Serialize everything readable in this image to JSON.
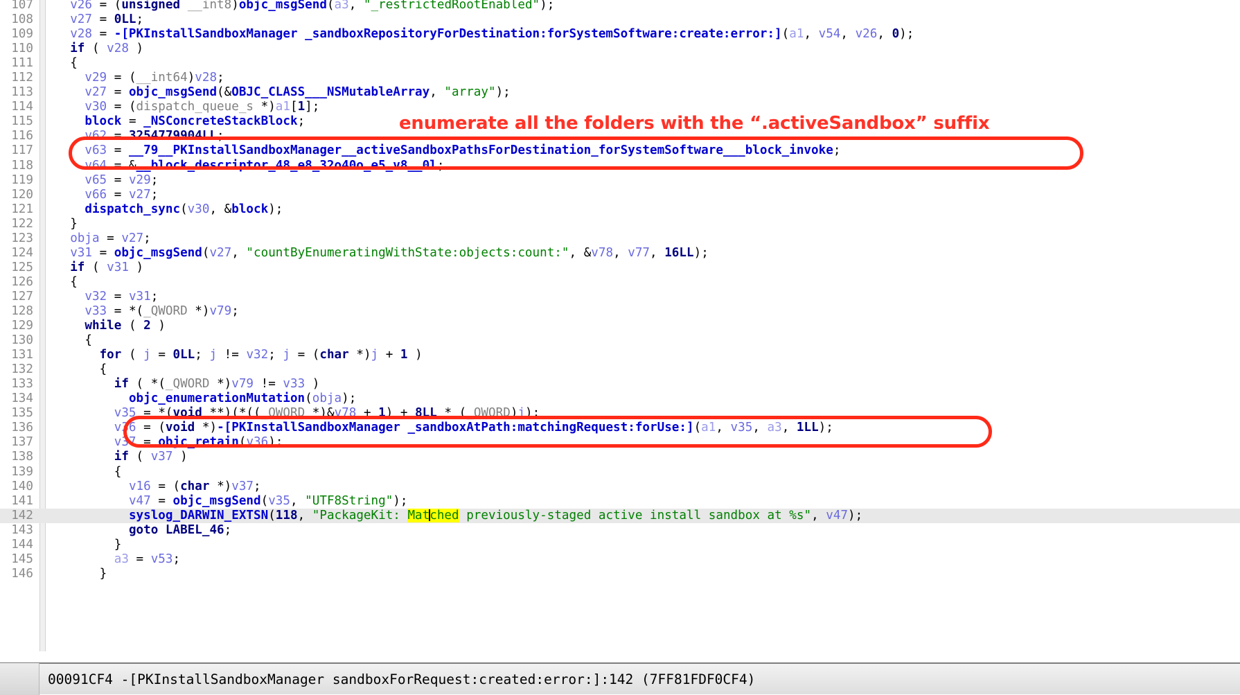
{
  "window": {
    "kind": "hex-rays-pseudocode-view"
  },
  "editor": {
    "first_line_number": 107,
    "highlighted_line_number": 142,
    "selected_word": "Matched",
    "selection_color": "#ffff00",
    "highlight_row_color": "#e8e8e8",
    "gutter_color": "#f0f0f0",
    "line_number_color": "#8b8b8b",
    "background": "#ffffff"
  },
  "syntax_colors": {
    "keyword": "#000080",
    "function": "#0000cf",
    "variable": "#6a6ade",
    "argument": "#9a9ae8",
    "string": "#008000",
    "type": "#808080",
    "plain": "#000000"
  },
  "code_lines": [
    {
      "n": 107,
      "text": "  v26 = (unsigned __int8)objc_msgSend(a3, \"_restrictedRootEnabled\");"
    },
    {
      "n": 108,
      "text": "  v27 = 0LL;"
    },
    {
      "n": 109,
      "text": "  v28 = -[PKInstallSandboxManager _sandboxRepositoryForDestination:forSystemSoftware:create:error:](a1, v54, v26, 0);"
    },
    {
      "n": 110,
      "text": "  if ( v28 )"
    },
    {
      "n": 111,
      "text": "  {"
    },
    {
      "n": 112,
      "text": "    v29 = (__int64)v28;"
    },
    {
      "n": 113,
      "text": "    v27 = objc_msgSend(&OBJC_CLASS___NSMutableArray, \"array\");"
    },
    {
      "n": 114,
      "text": "    v30 = (dispatch_queue_s *)a1[1];"
    },
    {
      "n": 115,
      "text": "    block = _NSConcreteStackBlock;"
    },
    {
      "n": 116,
      "text": "    v62 = 3254779904LL;"
    },
    {
      "n": 117,
      "text": "    v63 = __79__PKInstallSandboxManager__activeSandboxPathsForDestination_forSystemSoftware___block_invoke;"
    },
    {
      "n": 118,
      "text": "    v64 = &__block_descriptor_48_e8_32o40o_e5_v8__0l;"
    },
    {
      "n": 119,
      "text": "    v65 = v29;"
    },
    {
      "n": 120,
      "text": "    v66 = v27;"
    },
    {
      "n": 121,
      "text": "    dispatch_sync(v30, &block);"
    },
    {
      "n": 122,
      "text": "  }"
    },
    {
      "n": 123,
      "text": "  obja = v27;"
    },
    {
      "n": 124,
      "text": "  v31 = objc_msgSend(v27, \"countByEnumeratingWithState:objects:count:\", &v78, v77, 16LL);"
    },
    {
      "n": 125,
      "text": "  if ( v31 )"
    },
    {
      "n": 126,
      "text": "  {"
    },
    {
      "n": 127,
      "text": "    v32 = v31;"
    },
    {
      "n": 128,
      "text": "    v33 = *(_QWORD *)v79;"
    },
    {
      "n": 129,
      "text": "    while ( 2 )"
    },
    {
      "n": 130,
      "text": "    {"
    },
    {
      "n": 131,
      "text": "      for ( j = 0LL; j != v32; j = (char *)j + 1 )"
    },
    {
      "n": 132,
      "text": "      {"
    },
    {
      "n": 133,
      "text": "        if ( *(_QWORD *)v79 != v33 )"
    },
    {
      "n": 134,
      "text": "          objc_enumerationMutation(obja);"
    },
    {
      "n": 135,
      "text": "        v35 = *(void **)(*((_QWORD *)&v78 + 1) + 8LL * (_QWORD)j);"
    },
    {
      "n": 136,
      "text": "        v36 = (void *)-[PKInstallSandboxManager _sandboxAtPath:matchingRequest:forUse:](a1, v35, a3, 1LL);"
    },
    {
      "n": 137,
      "text": "        v37 = objc_retain(v36);"
    },
    {
      "n": 138,
      "text": "        if ( v37 )"
    },
    {
      "n": 139,
      "text": "        {"
    },
    {
      "n": 140,
      "text": "          v16 = (char *)v37;"
    },
    {
      "n": 141,
      "text": "          v47 = objc_msgSend(v35, \"UTF8String\");"
    },
    {
      "n": 142,
      "text": "          syslog_DARWIN_EXTSN(118, \"PackageKit: Matched previously-staged active install sandbox at %s\", v47);"
    },
    {
      "n": 143,
      "text": "          goto LABEL_46;"
    },
    {
      "n": 144,
      "text": "        }"
    },
    {
      "n": 145,
      "text": "        a3 = v53;"
    },
    {
      "n": 146,
      "text": "      }"
    }
  ],
  "annotations": [
    {
      "id": "note-enumerate-folders",
      "type": "text",
      "text": "enumerate all the folders with the “.activeSandbox” suffix",
      "color": "#ff3327"
    },
    {
      "id": "oval-line-117",
      "type": "ellipse",
      "targets_line": 117,
      "color": "#ff2a18"
    },
    {
      "id": "oval-line-136",
      "type": "ellipse",
      "targets_line": 136,
      "color": "#ff2a18"
    }
  ],
  "status_bar": {
    "address": "00091CF4",
    "text": "00091CF4 -[PKInstallSandboxManager sandboxForRequest:created:error:]:142 (7FF81FDF0CF4)",
    "symbol": "-[PKInstallSandboxManager sandboxForRequest:created:error:]",
    "line": "142",
    "runtime_address": "7FF81FDF0CF4"
  }
}
